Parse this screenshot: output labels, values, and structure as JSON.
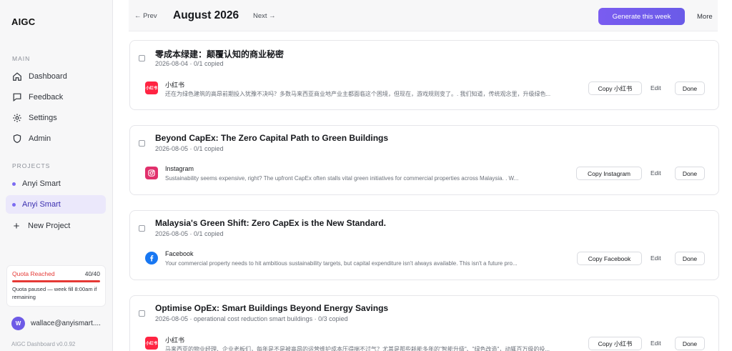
{
  "sidebar": {
    "brand": "AIGC",
    "main_label": "MAIN",
    "nav": [
      {
        "label": "Dashboard",
        "icon": "home-icon"
      },
      {
        "label": "Feedback",
        "icon": "message-icon"
      },
      {
        "label": "Settings",
        "icon": "gear-icon"
      },
      {
        "label": "Admin",
        "icon": "shield-icon"
      }
    ],
    "projects_label": "PROJECTS",
    "projects": [
      {
        "label": "Anyi Smart",
        "active": false
      },
      {
        "label": "Anyi Smart",
        "active": true
      }
    ],
    "new_project": "New Project",
    "quota": {
      "label": "Quota Reached",
      "count": "40/40",
      "used": 40,
      "total": 40,
      "text": "Quota paused — week fill 8:00am if remaining"
    },
    "user": {
      "initial": "W",
      "email": "wallace@anyismart...."
    },
    "version": "AIGC Dashboard v0.0.92"
  },
  "topbar": {
    "prev": "← Prev",
    "month": "August 2026",
    "next": "Next →",
    "generate": "Generate this week",
    "more": "More"
  },
  "colors": {
    "accent": "#7a5cf0",
    "danger": "#e53935",
    "xhs": "#ff2442",
    "instagram": "#e1306c",
    "facebook": "#1877f2"
  },
  "cards": [
    {
      "title": "零成本绿建：颠覆认知的商业秘密",
      "meta": "2026-08-04 · 0/1 copied",
      "platform": "小红书",
      "platform_icon": "xiaohongshu-icon",
      "icon_text": "小红书",
      "excerpt": "还在为绿色建筑的高昂前期投入犹豫不决吗？多数马来西亚商业地产业主都面临这个困境，但现在，游戏规则变了。. 我们知道，传统观念里，升级绿色...",
      "copy": "Copy 小红书",
      "edit": "Edit",
      "done": "Done"
    },
    {
      "title": "Beyond CapEx: The Zero Capital Path to Green Buildings",
      "meta": "2026-08-05 · 0/1 copied",
      "platform": "Instagram",
      "platform_icon": "instagram-icon",
      "icon_text": "",
      "excerpt": "Sustainability seems expensive, right? The upfront CapEx often stalls vital green initiatives for commercial properties across Malaysia. . W...",
      "copy": "Copy Instagram",
      "edit": "Edit",
      "done": "Done"
    },
    {
      "title": "Malaysia's Green Shift: Zero CapEx is the New Standard.",
      "meta": "2026-08-05 · 0/1 copied",
      "platform": "Facebook",
      "platform_icon": "facebook-icon",
      "icon_text": "",
      "excerpt": "Your commercial property needs to hit ambitious sustainability targets, but capital expenditure isn't always available. This isn't a future pro...",
      "copy": "Copy Facebook",
      "edit": "Edit",
      "done": "Done"
    },
    {
      "title": "Optimise OpEx: Smart Buildings Beyond Energy Savings",
      "meta": "2026-08-05 · operational cost reduction smart buildings · 0/3 copied",
      "platform": "小红书",
      "platform_icon": "xiaohongshu-icon",
      "icon_text": "小红书",
      "excerpt": "马来西亚的物业经理、企业老板们，每年是不是被高昂的运营维护成本压得喘不过气？尤其是那些耗能多年的\"智能升级\"、\"绿色改造\"，动辄百万级的投...",
      "copy": "Copy 小红书",
      "edit": "Edit",
      "done": "Done"
    }
  ]
}
